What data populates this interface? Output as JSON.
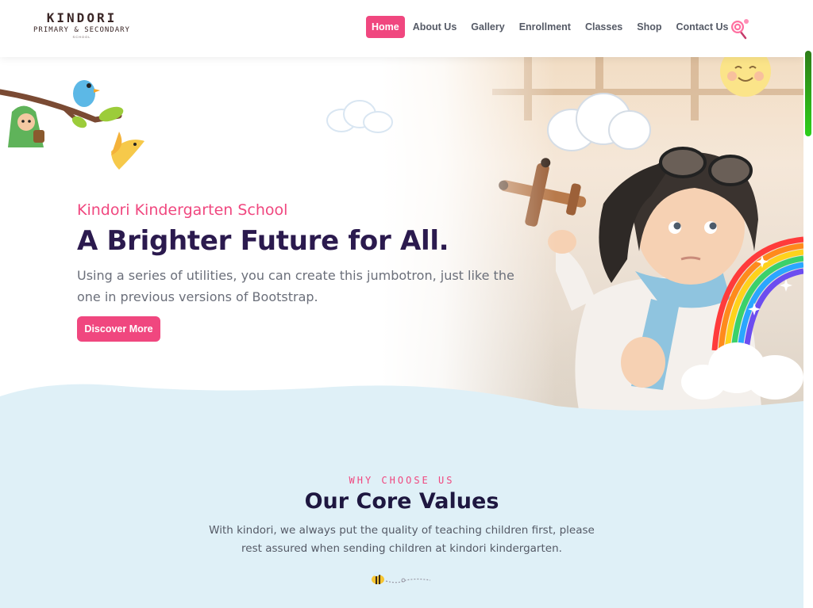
{
  "logo": {
    "name": "KINDORI",
    "subtitle": "PRIMARY & SECONDARY",
    "tagline": "SCHOOL"
  },
  "nav": {
    "items": [
      {
        "label": "Home",
        "active": true
      },
      {
        "label": "About Us"
      },
      {
        "label": "Gallery"
      },
      {
        "label": "Enrollment"
      },
      {
        "label": "Classes"
      },
      {
        "label": "Shop"
      },
      {
        "label": "Contact Us"
      }
    ],
    "search_icon": "search-lollipop-icon"
  },
  "hero": {
    "subtitle": "Kindori Kindergarten School",
    "title": "A Brighter Future for All.",
    "text": "Using a series of utilities, you can create this jumbotron, just like the one in previous versions of Bootstrap.",
    "button_label": "Discover More"
  },
  "values": {
    "eyebrow": "WHY CHOOSE US",
    "title": "Our Core Values",
    "text": "With kindori, we always put the quality of teaching children first, please rest assured when sending children at kindori kindergarten.",
    "divider_icon": "bee-icon"
  },
  "colors": {
    "accent": "#f0477f",
    "heading": "#2b1a4e",
    "section_bg": "#dff0f7",
    "scroll_thumb": "#2ecf1a"
  }
}
